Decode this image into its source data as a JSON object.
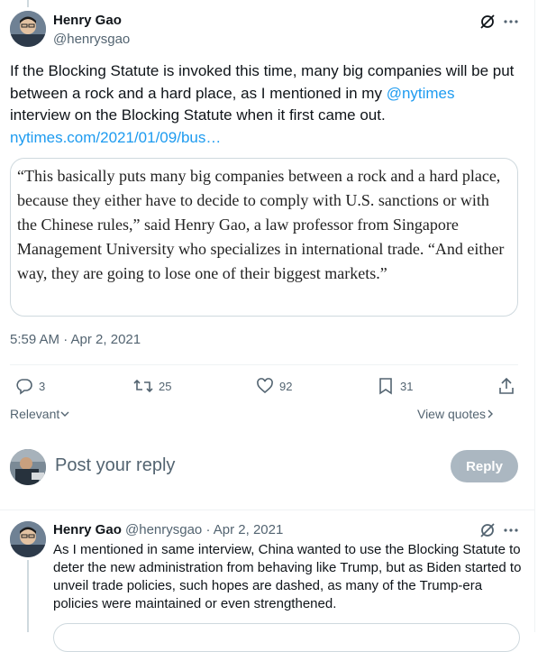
{
  "tweet": {
    "author_name": "Henry Gao",
    "author_handle": "@henrysgao",
    "text_part1": "If the Blocking Statute is invoked this time, many big companies will be put between a rock and a hard place, as I mentioned in my ",
    "mention": "@nytimes",
    "text_part2": " interview on the Blocking Statute when it first came out.",
    "link": "nytimes.com/2021/01/09/bus…",
    "quote": "“This basically puts many big companies between a rock and a hard place, because they either have to decide to comply with U.S. sanctions or with the Chinese rules,” said Henry Gao, a law professor from Singapore Management University who specializes in international trade. “And either way, they are going to lose one of their biggest markets.”",
    "timestamp": "5:59 AM · Apr 2, 2021",
    "stats": {
      "replies": "3",
      "reposts": "25",
      "likes": "92",
      "bookmarks": "31"
    }
  },
  "sort": {
    "label": "Relevant",
    "view_quotes": "View quotes"
  },
  "composer": {
    "placeholder": "Post your reply",
    "reply_button": "Reply"
  },
  "reply_tweet": {
    "author_name": "Henry Gao",
    "meta": "@henrysgao · Apr 2, 2021",
    "text": "As I mentioned in same interview, China wanted to use the Blocking Statute to deter the new administration from behaving like Trump, but as Biden started to unveil trade policies, such hopes are dashed, as many of the Trump-era policies were maintained or even strengthened."
  },
  "colors": {
    "link": "#1d9bf0",
    "secondary_text": "#536471",
    "border": "#cfd9de"
  }
}
